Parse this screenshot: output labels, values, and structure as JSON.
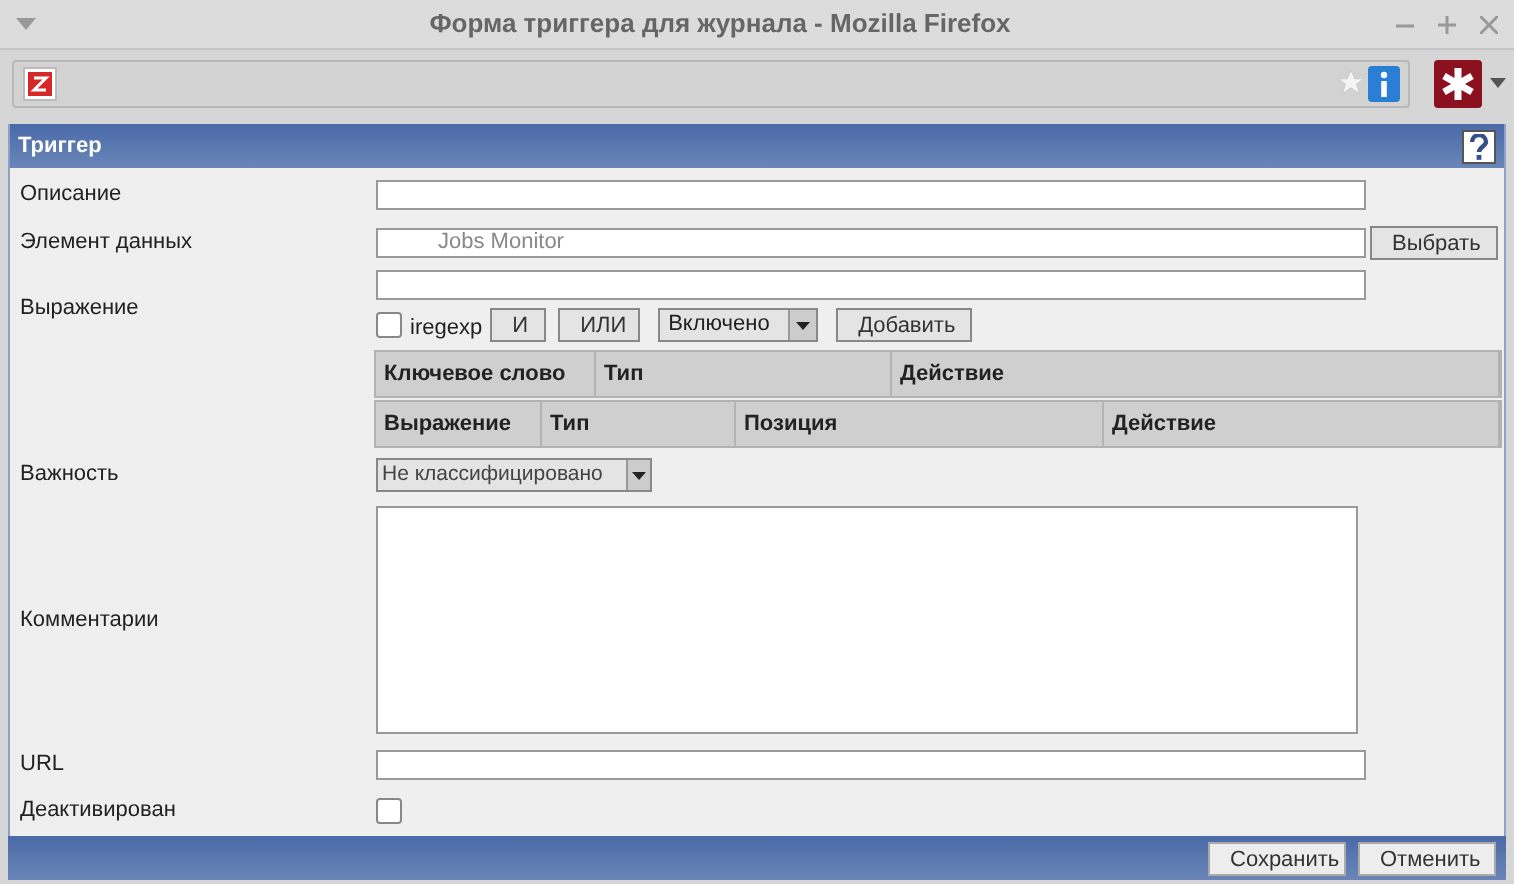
{
  "window": {
    "title": "Форма триггера для журнала - Mozilla Firefox"
  },
  "panel": {
    "title": "Триггер"
  },
  "description": {
    "label": "Описание"
  },
  "item": {
    "label": "Элемент данных",
    "value": "Jobs Monitor",
    "button": "Выбрать"
  },
  "expression": {
    "label": "Выражение",
    "iregexp_label": "iregexp",
    "iregexp_checked": false,
    "and_button": "И",
    "or_button": "ИЛИ",
    "mode": "Включено",
    "add_button": "Добавить"
  },
  "keywords_table": {
    "columns": [
      "Ключевое слово",
      "Тип",
      "Действие"
    ]
  },
  "expressions_table": {
    "columns": [
      "Выражение",
      "Тип",
      "Позиция",
      "Действие"
    ]
  },
  "severity": {
    "label": "Важность",
    "value": "Не классифицировано"
  },
  "comments": {
    "label": "Комментарии"
  },
  "url": {
    "label": "URL"
  },
  "disabled": {
    "label": "Деактивирован",
    "checked": false
  },
  "footer": {
    "buttons": [
      "Сохранить",
      "Отменить"
    ]
  }
}
